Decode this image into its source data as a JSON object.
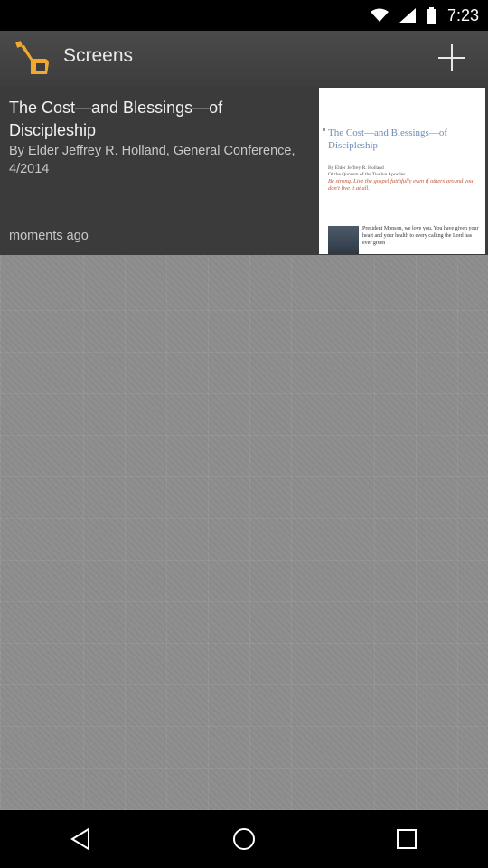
{
  "status_bar": {
    "time": "7:23"
  },
  "app_bar": {
    "title": "Screens"
  },
  "card": {
    "title": "The Cost—and Blessings—of Discipleship",
    "subtitle": "By Elder Jeffrey R. Holland, General Conference, 4/2014",
    "timestamp": "moments ago",
    "thumbnail": {
      "title": "The Cost—and Blessings—of Discipleship",
      "byline": "By Elder Jeffrey R. Holland\nOf the Quorum of the Twelve Apostles",
      "quote": "Be strong. Live the gospel faithfully even if others around you don't live it at all.",
      "body": "President Monson, we love you. You have given your heart and your health to every calling the Lord has ever given"
    }
  },
  "icons": {
    "app": "hand-pointer-icon",
    "add": "plus-icon",
    "back": "back-triangle-icon",
    "home": "home-circle-icon",
    "recents": "recents-square-icon"
  },
  "colors": {
    "app_bar": "#444444",
    "background": "#8f8f8f",
    "card": "#3b3b3b",
    "accent_icon": "#f0a830",
    "thumb_title": "#6b8db5",
    "thumb_quote": "#c0543a"
  }
}
